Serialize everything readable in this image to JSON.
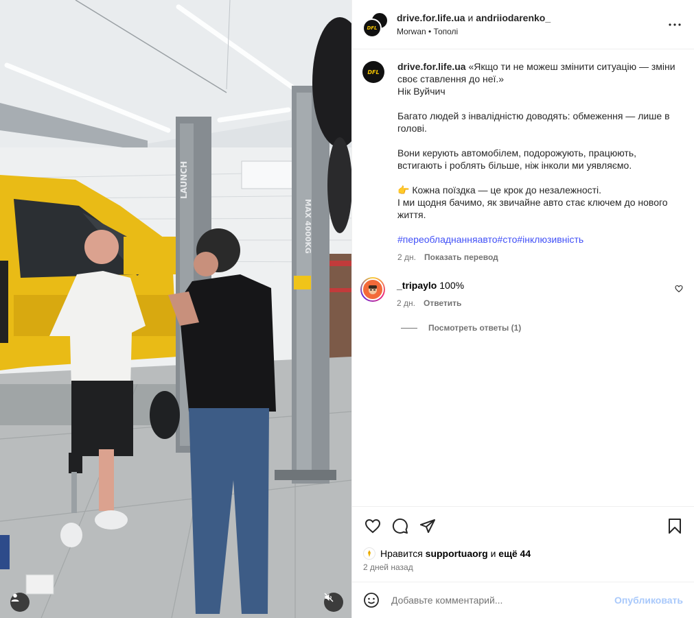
{
  "header": {
    "user1": "drive.for.life.ua",
    "conj": "и",
    "user2": "andriiodarenko_",
    "subtitle": "Morwan • Тополі"
  },
  "avatar_logo": "DFL",
  "caption": {
    "username": "drive.for.life.ua",
    "text": "«Якщо ти не можеш змінити ситуацію — зміни своє ставлення до неї.»\nНік Вуйчич\n\nБагато людей з інвалідністю доводять: обмеження — лише в голові.\n\nВони керують автомобілем, подорожують, працюють, встигають і роблять більше, ніж інколи ми уявляємо.\n\n👉 Кожна поїздка — це крок до незалежності.\nІ ми щодня бачимо, як звичайне авто стає ключем до нового життя.",
    "hashtags": [
      "#переобладнанняавто",
      "#сто",
      "#інклюзивність"
    ],
    "time": "2 дн.",
    "translate": "Показать перевод"
  },
  "comment": {
    "username": "_tripaylo",
    "text": "100%",
    "time": "2 дн.",
    "reply": "Ответить",
    "view_replies": "Посмотреть ответы (1)"
  },
  "likes": {
    "prefix": "Нравится",
    "user": "supportuaorg",
    "mid": "и",
    "rest": "ещё 44"
  },
  "date": "2 дней назад",
  "add_comment": {
    "placeholder": "Добавьте комментарий...",
    "post": "Опубликовать"
  },
  "icons": {
    "more": "more-icon",
    "like": "heart-icon",
    "comment": "comment-icon",
    "share": "share-icon",
    "save": "bookmark-icon",
    "emoji": "emoji-icon",
    "user_tag": "user-tag-icon",
    "mute": "mute-icon"
  },
  "colors": {
    "link": "#4150f7",
    "muted": "#737373",
    "post_disabled": "#a9c9fb"
  }
}
